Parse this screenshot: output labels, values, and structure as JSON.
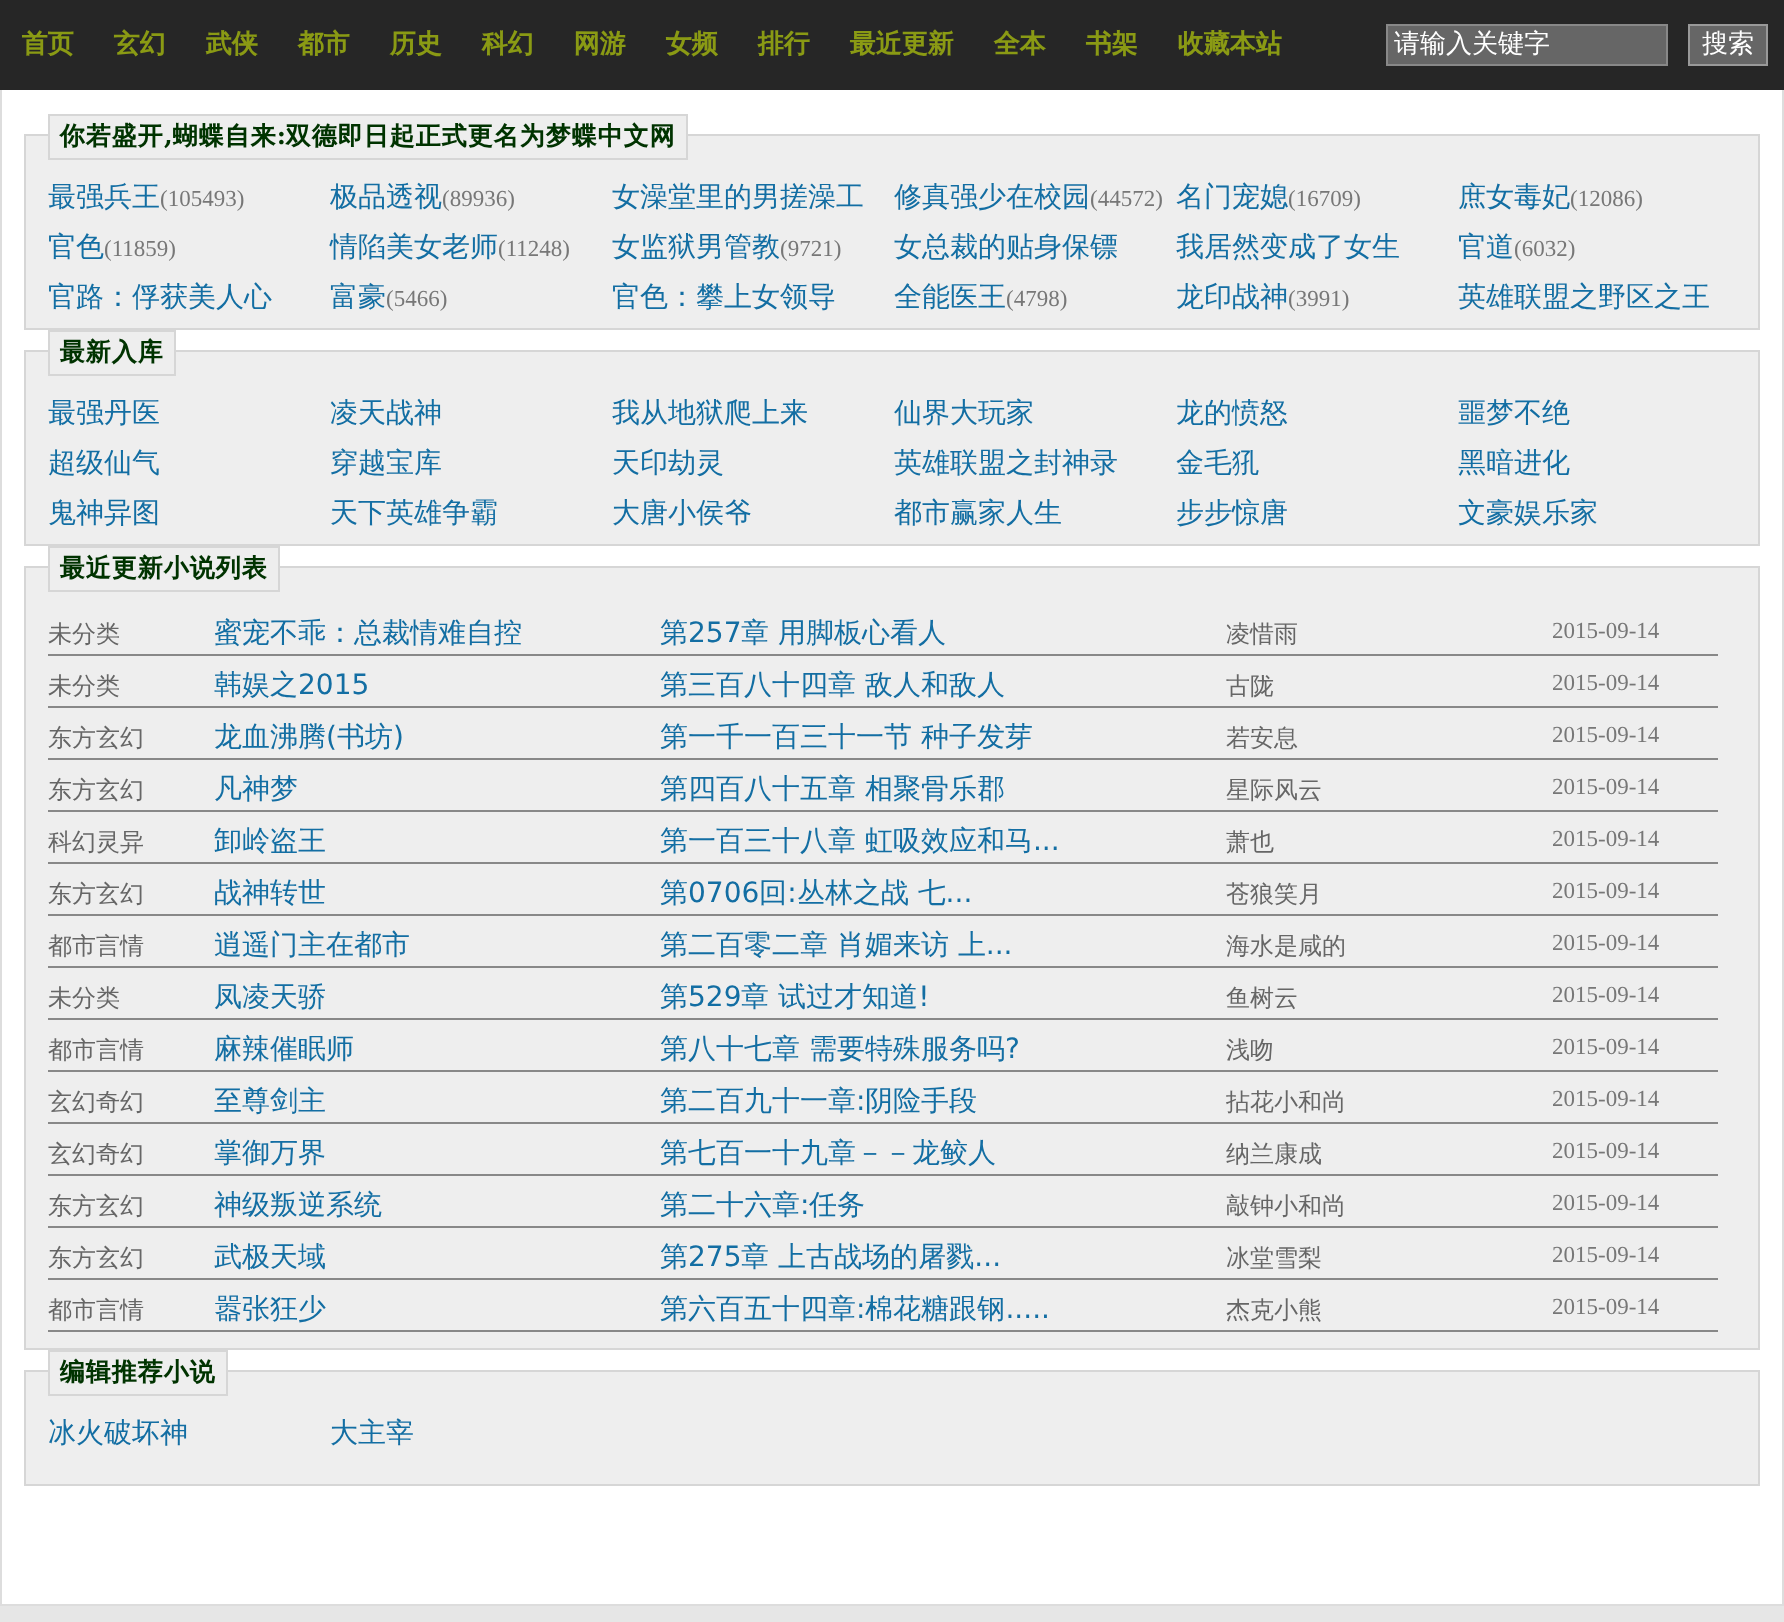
{
  "nav": {
    "links": [
      "首页",
      "玄幻",
      "武侠",
      "都市",
      "历史",
      "科幻",
      "网游",
      "女频",
      "排行",
      "最近更新",
      "全本",
      "书架",
      "收藏本站"
    ],
    "search": {
      "placeholder": "请输入关键字",
      "button": "搜索"
    }
  },
  "hot": {
    "title": "你若盛开,蝴蝶自来:双德即日起正式更名为梦蝶中文网",
    "items": [
      {
        "title": "最强兵王",
        "count": "(105493)"
      },
      {
        "title": "极品透视",
        "count": "(89936)"
      },
      {
        "title": "女澡堂里的男搓澡工"
      },
      {
        "title": "修真强少在校园",
        "count": "(44572)"
      },
      {
        "title": "名门宠媳",
        "count": "(16709)"
      },
      {
        "title": "庶女毒妃",
        "count": "(12086)"
      },
      {
        "title": "官色",
        "count": "(11859)"
      },
      {
        "title": "情陷美女老师",
        "count": "(11248)"
      },
      {
        "title": "女监狱男管教",
        "count": "(9721)"
      },
      {
        "title": "女总裁的贴身保镖"
      },
      {
        "title": "我居然变成了女生"
      },
      {
        "title": "官道",
        "count": "(6032)"
      },
      {
        "title": "官路：俘获美人心"
      },
      {
        "title": "富豪",
        "count": "(5466)"
      },
      {
        "title": "官色：攀上女领导"
      },
      {
        "title": "全能医王",
        "count": "(4798)"
      },
      {
        "title": "龙印战神",
        "count": "(3991)"
      },
      {
        "title": "英雄联盟之野区之王"
      }
    ]
  },
  "newest": {
    "title": "最新入库",
    "items": [
      {
        "title": "最强丹医"
      },
      {
        "title": "凌天战神"
      },
      {
        "title": "我从地狱爬上来"
      },
      {
        "title": "仙界大玩家"
      },
      {
        "title": "龙的愤怒"
      },
      {
        "title": "噩梦不绝"
      },
      {
        "title": "超级仙气"
      },
      {
        "title": "穿越宝库"
      },
      {
        "title": "天印劫灵"
      },
      {
        "title": "英雄联盟之封神录"
      },
      {
        "title": "金毛犼"
      },
      {
        "title": "黑暗进化"
      },
      {
        "title": "鬼神异图"
      },
      {
        "title": "天下英雄争霸"
      },
      {
        "title": "大唐小侯爷"
      },
      {
        "title": "都市赢家人生"
      },
      {
        "title": "步步惊唐"
      },
      {
        "title": "文豪娱乐家"
      }
    ]
  },
  "updates": {
    "title": "最近更新小说列表",
    "rows": [
      {
        "category": "未分类",
        "book": "蜜宠不乖：总裁情难自控",
        "chapter": "第257章 用脚板心看人",
        "author": "凌惜雨",
        "date": "2015-09-14"
      },
      {
        "category": "未分类",
        "book": "韩娱之2015",
        "chapter": "第三百八十四章 敌人和敌人",
        "author": "古陇",
        "date": "2015-09-14"
      },
      {
        "category": "东方玄幻",
        "book": "龙血沸腾(书坊)",
        "chapter": "第一千一百三十一节 种子发芽",
        "author": "若安息",
        "date": "2015-09-14"
      },
      {
        "category": "东方玄幻",
        "book": "凡神梦",
        "chapter": "第四百八十五章 相聚骨乐郡",
        "author": "星际风云",
        "date": "2015-09-14"
      },
      {
        "category": "科幻灵异",
        "book": "卸岭盗王",
        "chapter": "第一百三十八章 虹吸效应和马...",
        "author": "萧也",
        "date": "2015-09-14"
      },
      {
        "category": "东方玄幻",
        "book": "战神转世",
        "chapter": "第0706回:丛林之战 七...",
        "author": "苍狼笑月",
        "date": "2015-09-14"
      },
      {
        "category": "都市言情",
        "book": "逍遥门主在都市",
        "chapter": "第二百零二章 肖媚来访 上...",
        "author": "海水是咸的",
        "date": "2015-09-14"
      },
      {
        "category": "未分类",
        "book": "凤凌天骄",
        "chapter": "第529章 试过才知道!",
        "author": "鱼树云",
        "date": "2015-09-14"
      },
      {
        "category": "都市言情",
        "book": "麻辣催眠师",
        "chapter": "第八十七章 需要特殊服务吗?",
        "author": "浅吻",
        "date": "2015-09-14"
      },
      {
        "category": "玄幻奇幻",
        "book": "至尊剑主",
        "chapter": "第二百九十一章:阴险手段",
        "author": "拈花小和尚",
        "date": "2015-09-14"
      },
      {
        "category": "玄幻奇幻",
        "book": "掌御万界",
        "chapter": "第七百一十九章－－龙鲛人",
        "author": "纳兰康成",
        "date": "2015-09-14"
      },
      {
        "category": "东方玄幻",
        "book": "神级叛逆系统",
        "chapter": "第二十六章:任务",
        "author": "敲钟小和尚",
        "date": "2015-09-14"
      },
      {
        "category": "东方玄幻",
        "book": "武极天域",
        "chapter": "第275章 上古战场的屠戮...",
        "author": "冰堂雪梨",
        "date": "2015-09-14"
      },
      {
        "category": "都市言情",
        "book": "嚣张狂少",
        "chapter": "第六百五十四章:棉花糖跟钢.....",
        "author": "杰克小熊",
        "date": "2015-09-14"
      }
    ]
  },
  "recommend": {
    "title": "编辑推荐小说",
    "items": [
      {
        "title": "冰火破坏神"
      },
      {
        "title": "大主宰"
      }
    ]
  }
}
